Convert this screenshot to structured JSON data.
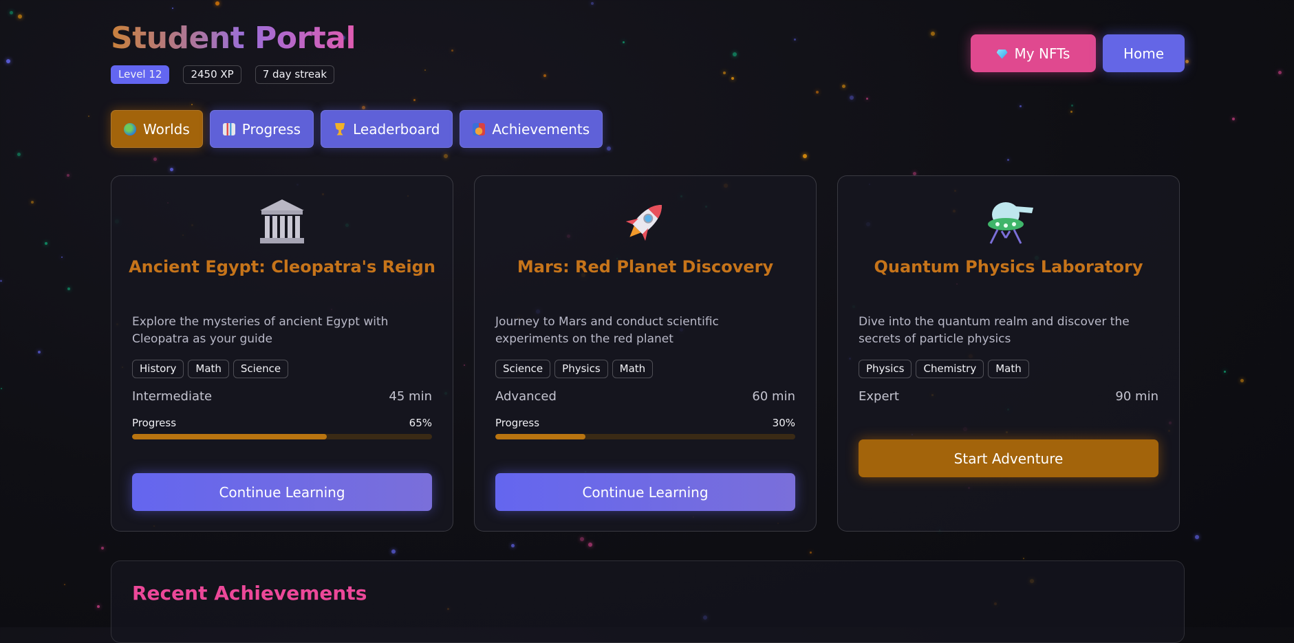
{
  "header": {
    "title": "Student Portal",
    "badges": {
      "level": "Level 12",
      "xp": "2450 XP",
      "streak": "7 day streak"
    },
    "buttons": {
      "nfts": "My NFTs",
      "home": "Home"
    }
  },
  "tabs": [
    {
      "label": "Worlds",
      "icon": "globe-icon",
      "active": true
    },
    {
      "label": "Progress",
      "icon": "bar-chart-icon",
      "active": false
    },
    {
      "label": "Leaderboard",
      "icon": "trophy-icon",
      "active": false
    },
    {
      "label": "Achievements",
      "icon": "medal-icon",
      "active": false
    }
  ],
  "worlds": [
    {
      "icon": "classical-building-icon",
      "title": "Ancient Egypt: Cleopatra's Reign",
      "description": "Explore the mysteries of ancient Egypt with Cleopatra as your guide",
      "tags": [
        "History",
        "Math",
        "Science"
      ],
      "difficulty": "Intermediate",
      "duration": "45 min",
      "progress_label": "Progress",
      "progress_text": "65%",
      "progress_fraction": 0.65,
      "cta": "Continue Learning"
    },
    {
      "icon": "rocket-icon",
      "title": "Mars: Red Planet Discovery",
      "description": "Journey to Mars and conduct scientific experiments on the red planet",
      "tags": [
        "Science",
        "Physics",
        "Math"
      ],
      "difficulty": "Advanced",
      "duration": "60 min",
      "progress_label": "Progress",
      "progress_text": "30%",
      "progress_fraction": 0.3,
      "cta": "Continue Learning"
    },
    {
      "icon": "flying-saucer-icon",
      "title": "Quantum Physics Laboratory",
      "description": "Dive into the quantum realm and discover the secrets of particle physics",
      "tags": [
        "Physics",
        "Chemistry",
        "Math"
      ],
      "difficulty": "Expert",
      "duration": "90 min",
      "cta": "Start Adventure"
    }
  ],
  "achievements": {
    "title": "Recent Achievements"
  },
  "colors": {
    "accent_primary": "#6366f1",
    "accent_amber": "#a3640b",
    "accent_pink": "#ec4899",
    "title_orange": "#c6741a"
  }
}
